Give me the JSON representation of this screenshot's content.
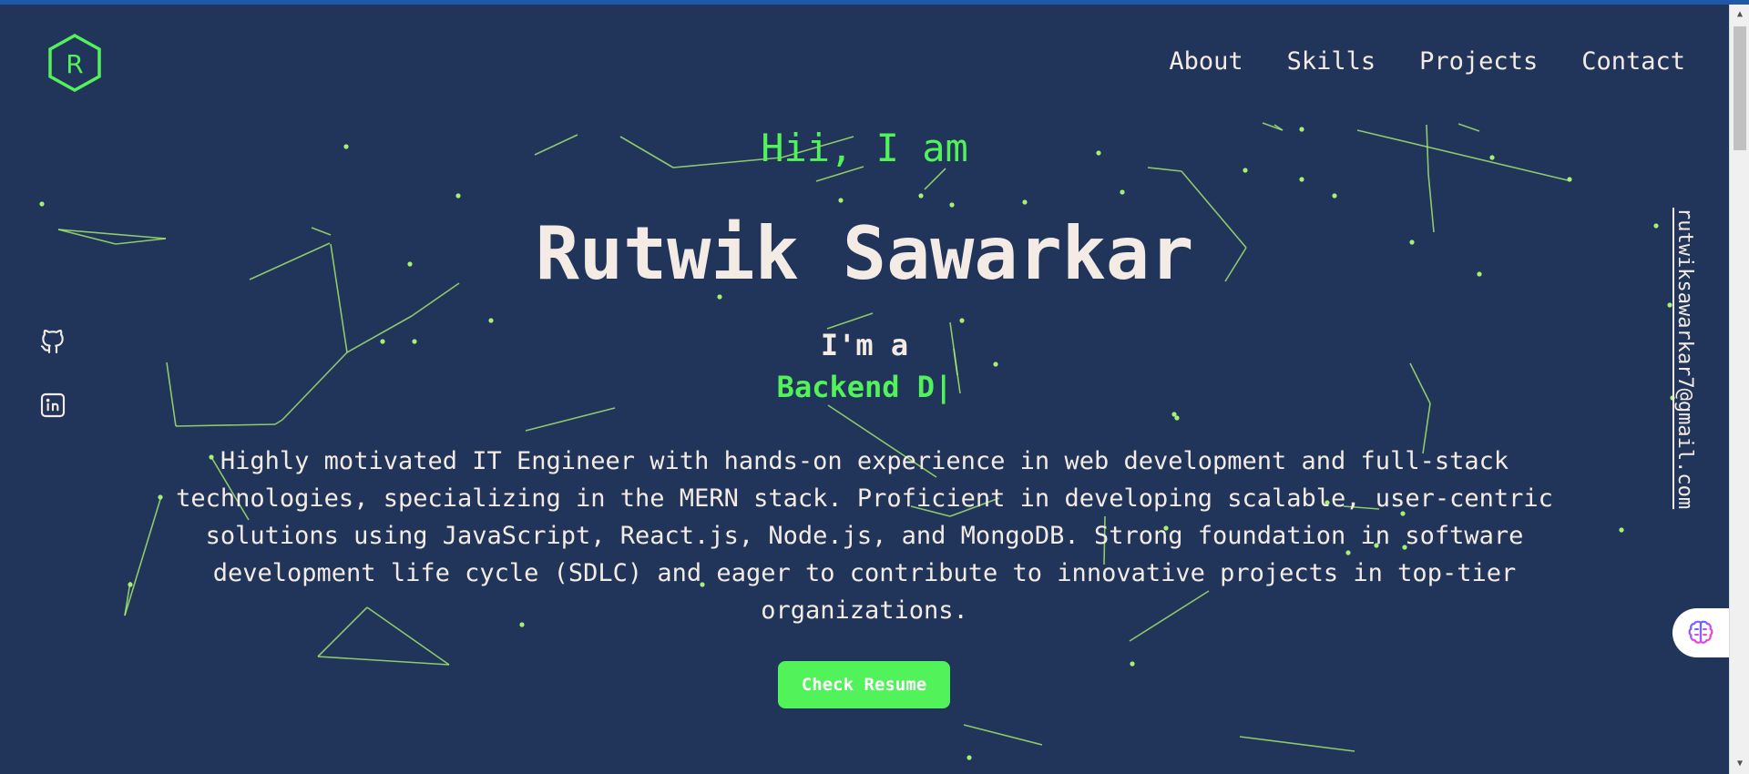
{
  "header": {
    "logo_letter": "R",
    "nav": [
      {
        "label": "About"
      },
      {
        "label": "Skills"
      },
      {
        "label": "Projects"
      },
      {
        "label": "Contact"
      }
    ]
  },
  "social": {
    "icons": [
      "github-icon",
      "linkedin-icon"
    ]
  },
  "email": "rutwiksawarkar7@gmail.com",
  "hero": {
    "greeting": "Hii, I am",
    "name": "Rutwik Sawarkar",
    "intro": "I'm a",
    "role_typed": "Backend D|",
    "bio": "Highly motivated IT Engineer with hands-on experience in web development and full-stack technologies, specializing in the MERN stack. Proficient in developing scalable, user-centric solutions using JavaScript, React.js, Node.js, and MongoDB. Strong foundation in software development life cycle (SDLC) and eager to contribute to innovative projects in top-tier organizations.",
    "button_label": "Check Resume"
  },
  "colors": {
    "background": "#21345a",
    "accent": "#52f25a",
    "text": "#f4ece4",
    "particle": "#a8f070"
  },
  "assistant_icon": "brain-icon"
}
